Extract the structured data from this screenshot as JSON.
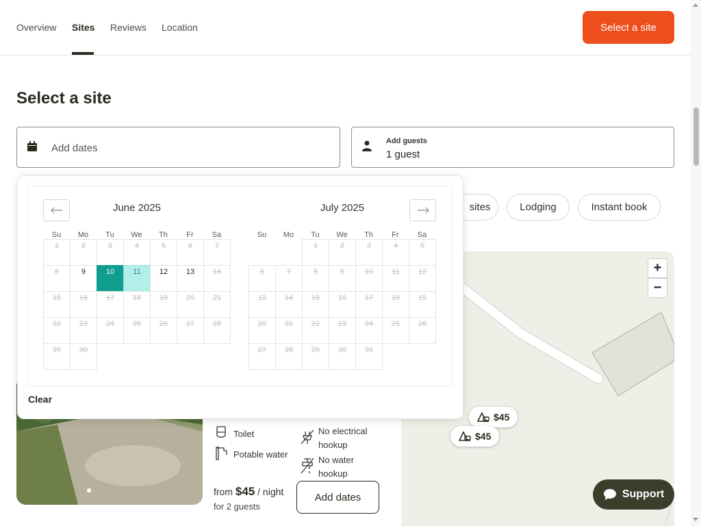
{
  "nav": {
    "tabs": [
      {
        "label": "Overview"
      },
      {
        "label": "Sites"
      },
      {
        "label": "Reviews"
      },
      {
        "label": "Location"
      }
    ],
    "cta_label": "Select a site"
  },
  "page_title": "Select a site",
  "dates_field": {
    "placeholder": "Add dates",
    "icon": "calendar-icon"
  },
  "guests_field": {
    "label": "Add guests",
    "value": "1 guest",
    "icon": "person-icon"
  },
  "filters": [
    {
      "label": "sites"
    },
    {
      "label": "Lodging"
    },
    {
      "label": "Instant book"
    }
  ],
  "calendar": {
    "months": [
      {
        "title": "June 2025"
      },
      {
        "title": "July 2025"
      }
    ],
    "weekdays": [
      "Su",
      "Mo",
      "Tu",
      "We",
      "Th",
      "Fr",
      "Sa"
    ],
    "clear_label": "Clear",
    "selected_start": "10",
    "selected_range": "11"
  },
  "site": {
    "amenities": [
      {
        "label": "Toilet",
        "icon": "toilet-icon"
      },
      {
        "label": "Potable water",
        "icon": "water-tap-icon"
      },
      {
        "label": "No electrical hookup",
        "line1": "No electrical",
        "line2": "hookup",
        "icon": "no-electric-icon"
      },
      {
        "label": "No water hookup",
        "line1": "No water",
        "line2": "hookup",
        "icon": "no-water-icon"
      }
    ],
    "price_prefix": "from",
    "price": "$45",
    "price_suffix": "/ night",
    "guests_note": "for 2 guests",
    "add_dates_label": "Add dates"
  },
  "map": {
    "pins": [
      {
        "label": "$45"
      },
      {
        "label": "$45"
      }
    ],
    "zoom_in": "+",
    "zoom_out": "−"
  },
  "support_label": "Support",
  "colors": {
    "accent": "#ec4f1c",
    "selected": "#0e9d8f",
    "range": "#b2eeea",
    "dark": "#3c3d2b"
  }
}
